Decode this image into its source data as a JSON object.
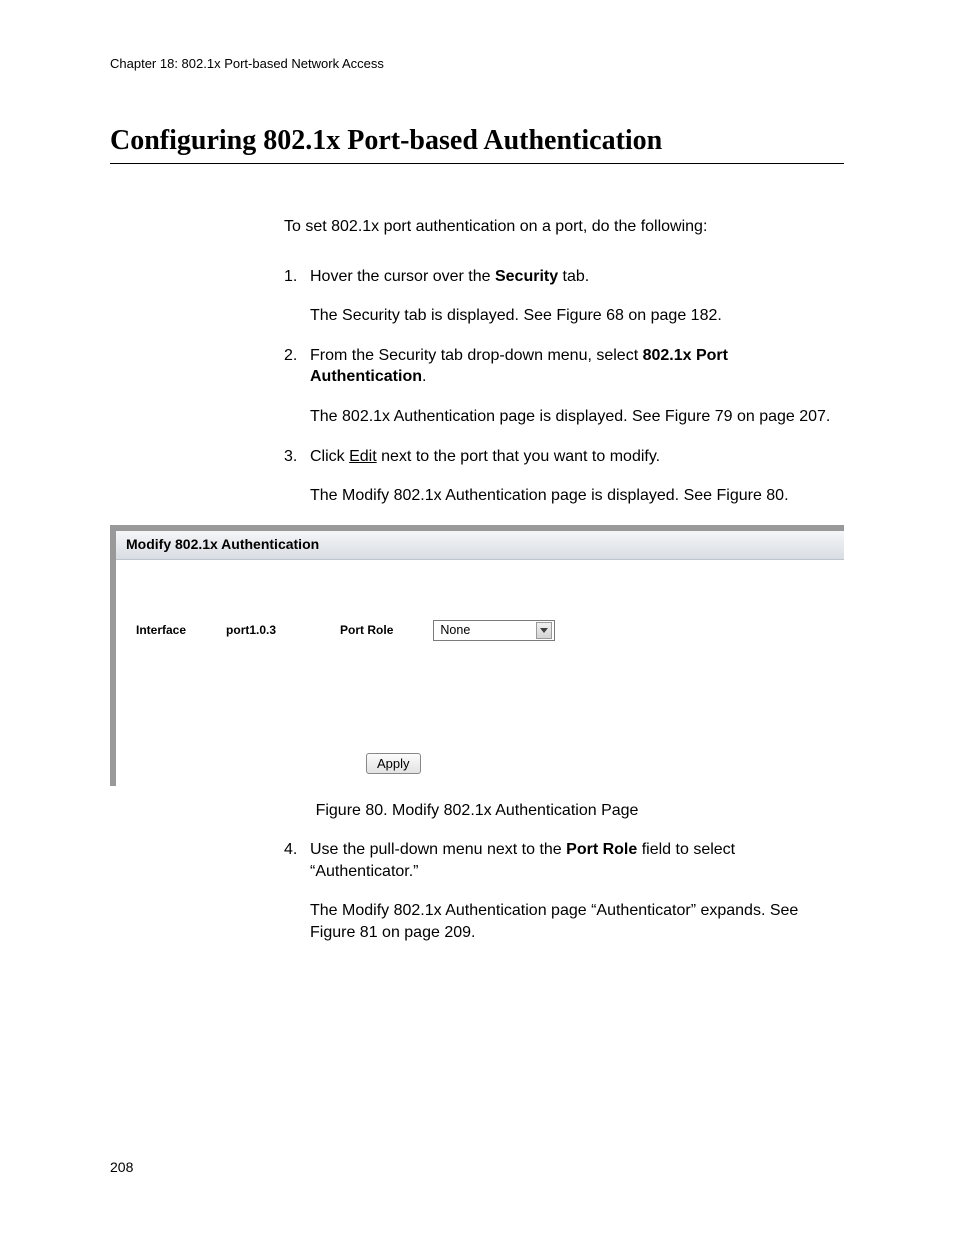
{
  "chapter_header": "Chapter 18: 802.1x Port-based Network Access",
  "heading": "Configuring 802.1x Port-based Authentication",
  "intro": "To set 802.1x port authentication on a port, do the following:",
  "steps": {
    "s1": {
      "num": "1.",
      "line1a": "Hover the cursor over the ",
      "line1b_bold": "Security",
      "line1c": " tab.",
      "line2": "The Security tab is displayed. See Figure 68 on page 182."
    },
    "s2": {
      "num": "2.",
      "line1a": "From the Security tab drop-down menu, select ",
      "line1b_bold": "802.1x Port Authentication",
      "line1c": ".",
      "line2": "The 802.1x Authentication page is displayed. See Figure 79 on page 207."
    },
    "s3": {
      "num": "3.",
      "line1a": "Click ",
      "line1b_under": "Edit",
      "line1c": " next to the port that you want to modify.",
      "line2": "The Modify 802.1x Authentication page is displayed. See Figure 80."
    },
    "s4": {
      "num": "4.",
      "line1a": "Use the pull-down menu next to the ",
      "line1b_bold": "Port Role",
      "line1c": " field to select “Authenticator.”",
      "line2": "The Modify 802.1x Authentication page “Authenticator” expands. See Figure 81 on page 209."
    }
  },
  "figure": {
    "panel_title": "Modify 802.1x Authentication",
    "interface_label": "Interface",
    "interface_value": "port1.0.3",
    "portrole_label": "Port Role",
    "portrole_value": "None",
    "apply_label": "Apply",
    "caption": "Figure 80. Modify 802.1x Authentication Page"
  },
  "page_number": "208"
}
